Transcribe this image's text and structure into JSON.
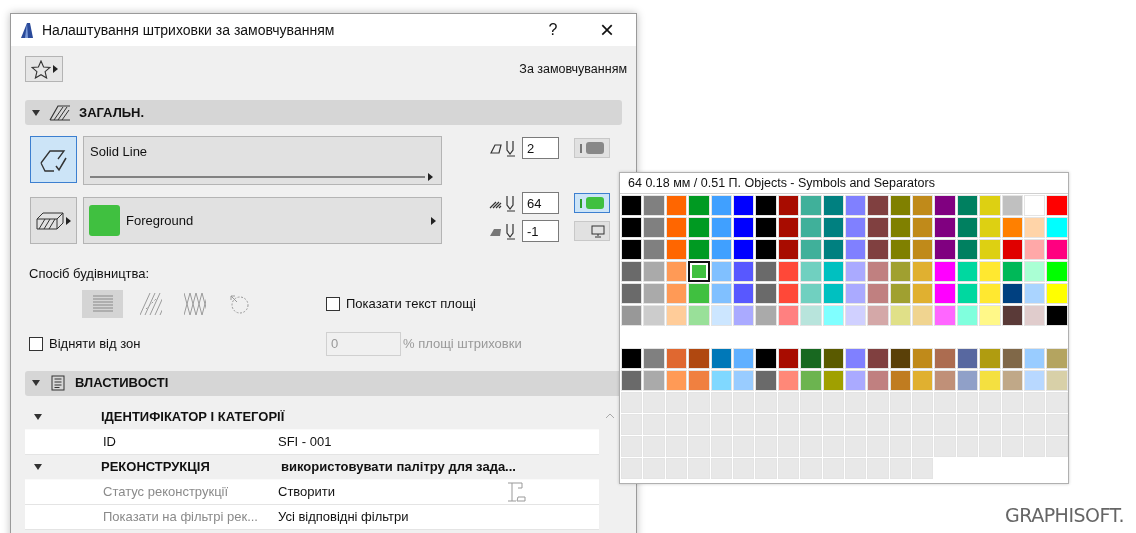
{
  "window": {
    "title": "Налаштування штриховки за замовчуванням",
    "help": "?",
    "close": "×"
  },
  "favorites": {
    "label": "За замовчуванням"
  },
  "general": {
    "title": "ЗАГАЛЬН.",
    "expanded": true,
    "line_type": {
      "label": "Solid Line",
      "selected": true
    },
    "fill": {
      "label": "Foreground",
      "color": "#40c040"
    },
    "pens": [
      {
        "kind": "contour",
        "value": "2",
        "toggle_on": false
      },
      {
        "kind": "foreground",
        "value": "64",
        "toggle_on": true
      },
      {
        "kind": "background",
        "value": "-1"
      }
    ],
    "construction_label": "Спосіб будівництва:",
    "construction_methods": [
      {
        "kind": "solid",
        "selected": true
      },
      {
        "kind": "hatched",
        "selected": false
      },
      {
        "kind": "crossed",
        "selected": false
      },
      {
        "kind": "rotated",
        "selected": false
      }
    ],
    "show_area_text": {
      "label": "Показати текст площі",
      "checked": false
    },
    "subtract_zones": {
      "label": "Відняти від зон",
      "checked": false
    },
    "area_percent": {
      "value": "0",
      "suffix": "% площі штриховки",
      "disabled": true
    }
  },
  "properties": {
    "title": "ВЛАСТИВОСТІ",
    "expanded": true,
    "groups": [
      {
        "name": "ІДЕНТИФІКАТОР І КАТЕГОРІЇ",
        "expanded": true,
        "children": [
          {
            "name": "ID",
            "value": "SFI - 001",
            "disabled": false
          }
        ]
      },
      {
        "name": "РЕКОНСТРУКЦІЯ",
        "value": "використовувати палітру для зада...",
        "expanded": true,
        "children": [
          {
            "name": "Статус реконструкції",
            "value": "Створити",
            "disabled": true,
            "has_icon": true
          },
          {
            "name": "Показати на фільтрі рек...",
            "value": "Усі відповідні фільтри",
            "disabled": true
          }
        ]
      }
    ]
  },
  "palette": {
    "header": "64  0.18 мм /  0.51 П. Objects - Symbols and Separators",
    "groups": [
      {
        "rows": [
          [
            {
              "color": "#000000",
              "selected": false
            },
            {
              "color": "#808080",
              "selected": false
            },
            {
              "color": "#ff6600",
              "selected": false
            },
            {
              "color": "#009a22",
              "selected": false
            },
            {
              "color": "#40a0ff",
              "selected": false
            },
            {
              "color": "#0000ff",
              "selected": false
            },
            {
              "color": "#000000",
              "selected": false
            },
            {
              "color": "#a80c00",
              "selected": false
            },
            {
              "color": "#40b09a",
              "selected": false
            },
            {
              "color": "#008080",
              "selected": false
            },
            {
              "color": "#8080ff",
              "selected": false
            },
            {
              "color": "#804040",
              "selected": false
            },
            {
              "color": "#808000",
              "selected": false
            },
            {
              "color": "#c08a1a",
              "selected": false
            },
            {
              "color": "#800080",
              "selected": false
            },
            {
              "color": "#008060",
              "selected": false
            },
            {
              "color": "#ddd012",
              "selected": false
            },
            {
              "color": "#c0c0c0",
              "selected": false
            },
            {
              "color": "#ffffff",
              "selected": false
            },
            {
              "color": "#ff0000",
              "selected": false
            }
          ],
          [
            {
              "color": "#000000",
              "selected": false
            },
            {
              "color": "#808080",
              "selected": false
            },
            {
              "color": "#ff6600",
              "selected": false
            },
            {
              "color": "#009a22",
              "selected": false
            },
            {
              "color": "#40a0ff",
              "selected": false
            },
            {
              "color": "#0000ff",
              "selected": false
            },
            {
              "color": "#000000",
              "selected": false
            },
            {
              "color": "#a80c00",
              "selected": false
            },
            {
              "color": "#40b09a",
              "selected": false
            },
            {
              "color": "#008080",
              "selected": false
            },
            {
              "color": "#8080ff",
              "selected": false
            },
            {
              "color": "#804040",
              "selected": false
            },
            {
              "color": "#808000",
              "selected": false
            },
            {
              "color": "#c08a1a",
              "selected": false
            },
            {
              "color": "#800080",
              "selected": false
            },
            {
              "color": "#008060",
              "selected": false
            },
            {
              "color": "#ddd012",
              "selected": false
            },
            {
              "color": "#ff8000",
              "selected": false
            },
            {
              "color": "#ffd4a8",
              "selected": false
            },
            {
              "color": "#00ffff",
              "selected": false
            }
          ],
          [
            {
              "color": "#000000",
              "selected": false
            },
            {
              "color": "#808080",
              "selected": false
            },
            {
              "color": "#ff6600",
              "selected": false
            },
            {
              "color": "#009a22",
              "selected": false
            },
            {
              "color": "#40a0ff",
              "selected": false
            },
            {
              "color": "#0000ff",
              "selected": false
            },
            {
              "color": "#000000",
              "selected": false
            },
            {
              "color": "#a80c00",
              "selected": false
            },
            {
              "color": "#40b09a",
              "selected": false
            },
            {
              "color": "#008080",
              "selected": false
            },
            {
              "color": "#8080ff",
              "selected": false
            },
            {
              "color": "#804040",
              "selected": false
            },
            {
              "color": "#808000",
              "selected": false
            },
            {
              "color": "#c08a1a",
              "selected": false
            },
            {
              "color": "#800080",
              "selected": false
            },
            {
              "color": "#008060",
              "selected": false
            },
            {
              "color": "#ddd012",
              "selected": false
            },
            {
              "color": "#e00000",
              "selected": false
            },
            {
              "color": "#ffa8a8",
              "selected": false
            },
            {
              "color": "#ff0080",
              "selected": false
            }
          ],
          [
            {
              "color": "#6a6a6a",
              "selected": false
            },
            {
              "color": "#aaaaaa",
              "selected": false
            },
            {
              "color": "#ff9a56",
              "selected": false
            },
            {
              "color": "#40c040",
              "selected": true
            },
            {
              "color": "#80c0ff",
              "selected": false
            },
            {
              "color": "#5858ff",
              "selected": false
            },
            {
              "color": "#6a6a6a",
              "selected": false
            },
            {
              "color": "#ff4838",
              "selected": false
            },
            {
              "color": "#70d0c0",
              "selected": false
            },
            {
              "color": "#00c0c0",
              "selected": false
            },
            {
              "color": "#aaaaff",
              "selected": false
            },
            {
              "color": "#c08080",
              "selected": false
            },
            {
              "color": "#a0a030",
              "selected": false
            },
            {
              "color": "#e0b030",
              "selected": false
            },
            {
              "color": "#ff00ff",
              "selected": false
            },
            {
              "color": "#00d8a0",
              "selected": false
            },
            {
              "color": "#ffe830",
              "selected": false
            },
            {
              "color": "#00b858",
              "selected": false
            },
            {
              "color": "#aaffd4",
              "selected": false
            },
            {
              "color": "#00ff00",
              "selected": false
            }
          ],
          [
            {
              "color": "#6a6a6a",
              "selected": false
            },
            {
              "color": "#aaaaaa",
              "selected": false
            },
            {
              "color": "#ff9a56",
              "selected": false
            },
            {
              "color": "#40c040",
              "selected": false
            },
            {
              "color": "#80c0ff",
              "selected": false
            },
            {
              "color": "#5858ff",
              "selected": false
            },
            {
              "color": "#6a6a6a",
              "selected": false
            },
            {
              "color": "#ff4838",
              "selected": false
            },
            {
              "color": "#70d0c0",
              "selected": false
            },
            {
              "color": "#00c0c0",
              "selected": false
            },
            {
              "color": "#aaaaff",
              "selected": false
            },
            {
              "color": "#c08080",
              "selected": false
            },
            {
              "color": "#a0a030",
              "selected": false
            },
            {
              "color": "#e0b030",
              "selected": false
            },
            {
              "color": "#ff00ff",
              "selected": false
            },
            {
              "color": "#00d8a0",
              "selected": false
            },
            {
              "color": "#ffe830",
              "selected": false
            },
            {
              "color": "#004080",
              "selected": false
            },
            {
              "color": "#aad4ff",
              "selected": false
            },
            {
              "color": "#ffff00",
              "selected": false
            }
          ],
          [
            {
              "color": "#989898",
              "selected": false
            },
            {
              "color": "#cccccc",
              "selected": false
            },
            {
              "color": "#ffcc99",
              "selected": false
            },
            {
              "color": "#99e099",
              "selected": false
            },
            {
              "color": "#cce6ff",
              "selected": false
            },
            {
              "color": "#aaaaff",
              "selected": false
            },
            {
              "color": "#aaaaaa",
              "selected": false
            },
            {
              "color": "#ff8080",
              "selected": false
            },
            {
              "color": "#b8e4dc",
              "selected": false
            },
            {
              "color": "#80ffff",
              "selected": false
            },
            {
              "color": "#d0d0ff",
              "selected": false
            },
            {
              "color": "#d4a8a8",
              "selected": false
            },
            {
              "color": "#e0e088",
              "selected": false
            },
            {
              "color": "#f0d490",
              "selected": false
            },
            {
              "color": "#ff66ff",
              "selected": false
            },
            {
              "color": "#80ffdd",
              "selected": false
            },
            {
              "color": "#fff888",
              "selected": false
            },
            {
              "color": "#5a3a38",
              "selected": false
            },
            {
              "color": "#e0cccc",
              "selected": false
            },
            {
              "color": "#000000",
              "selected": false
            }
          ]
        ]
      },
      {
        "rows": [
          [
            {
              "color": "#000000",
              "selected": false
            },
            {
              "color": "#808080",
              "selected": false
            },
            {
              "color": "#e06830",
              "selected": false
            },
            {
              "color": "#b04810",
              "selected": false
            },
            {
              "color": "#0078b8",
              "selected": false
            },
            {
              "color": "#60b0ff",
              "selected": false
            },
            {
              "color": "#000000",
              "selected": false
            },
            {
              "color": "#a80c00",
              "selected": false
            },
            {
              "color": "#186820",
              "selected": false
            },
            {
              "color": "#5a5a00",
              "selected": false
            },
            {
              "color": "#8080ff",
              "selected": false
            },
            {
              "color": "#804040",
              "selected": false
            },
            {
              "color": "#5a4008",
              "selected": false
            },
            {
              "color": "#c08a1a",
              "selected": false
            },
            {
              "color": "#ac6c50",
              "selected": false
            },
            {
              "color": "#5868a0",
              "selected": false
            },
            {
              "color": "#b09c10",
              "selected": false
            },
            {
              "color": "#806848",
              "selected": false
            },
            {
              "color": "#99ccff",
              "selected": false
            },
            {
              "color": "#b4a460",
              "selected": false
            }
          ],
          [
            {
              "color": "#6a6a6a",
              "selected": false
            },
            {
              "color": "#aaaaaa",
              "selected": false
            },
            {
              "color": "#ff9a56",
              "selected": false
            },
            {
              "color": "#f08040",
              "selected": false
            },
            {
              "color": "#80d8ff",
              "selected": false
            },
            {
              "color": "#99ccff",
              "selected": false
            },
            {
              "color": "#6a6a6a",
              "selected": false
            },
            {
              "color": "#ff8878",
              "selected": false
            },
            {
              "color": "#6cb450",
              "selected": false
            },
            {
              "color": "#a0a000",
              "selected": false
            },
            {
              "color": "#aaaaff",
              "selected": false
            },
            {
              "color": "#c08080",
              "selected": false
            },
            {
              "color": "#c07c20",
              "selected": false
            },
            {
              "color": "#e0b030",
              "selected": false
            },
            {
              "color": "#c09078",
              "selected": false
            },
            {
              "color": "#90a0c8",
              "selected": false
            },
            {
              "color": "#f4e040",
              "selected": false
            },
            {
              "color": "#c0a888",
              "selected": false
            },
            {
              "color": "#b8d8ff",
              "selected": false
            },
            {
              "color": "#d8d0a8",
              "selected": false
            }
          ],
          [
            {
              "color": "#e8e8e8",
              "selected": false
            },
            {
              "color": "#e8e8e8",
              "selected": false
            },
            {
              "color": "#e8e8e8",
              "selected": false
            },
            {
              "color": "#e8e8e8",
              "selected": false
            },
            {
              "color": "#e8e8e8",
              "selected": false
            },
            {
              "color": "#e8e8e8",
              "selected": false
            },
            {
              "color": "#e8e8e8",
              "selected": false
            },
            {
              "color": "#e8e8e8",
              "selected": false
            },
            {
              "color": "#e8e8e8",
              "selected": false
            },
            {
              "color": "#e8e8e8",
              "selected": false
            },
            {
              "color": "#e8e8e8",
              "selected": false
            },
            {
              "color": "#e8e8e8",
              "selected": false
            },
            {
              "color": "#e8e8e8",
              "selected": false
            },
            {
              "color": "#e8e8e8",
              "selected": false
            },
            {
              "color": "#e8e8e8",
              "selected": false
            },
            {
              "color": "#e8e8e8",
              "selected": false
            },
            {
              "color": "#e8e8e8",
              "selected": false
            },
            {
              "color": "#e8e8e8",
              "selected": false
            },
            {
              "color": "#e8e8e8",
              "selected": false
            },
            {
              "color": "#e8e8e8",
              "selected": false
            }
          ],
          [
            {
              "color": "#e8e8e8",
              "selected": false
            },
            {
              "color": "#e8e8e8",
              "selected": false
            },
            {
              "color": "#e8e8e8",
              "selected": false
            },
            {
              "color": "#e8e8e8",
              "selected": false
            },
            {
              "color": "#e8e8e8",
              "selected": false
            },
            {
              "color": "#e8e8e8",
              "selected": false
            },
            {
              "color": "#e8e8e8",
              "selected": false
            },
            {
              "color": "#e8e8e8",
              "selected": false
            },
            {
              "color": "#e8e8e8",
              "selected": false
            },
            {
              "color": "#e8e8e8",
              "selected": false
            },
            {
              "color": "#e8e8e8",
              "selected": false
            },
            {
              "color": "#e8e8e8",
              "selected": false
            },
            {
              "color": "#e8e8e8",
              "selected": false
            },
            {
              "color": "#e8e8e8",
              "selected": false
            },
            {
              "color": "#e8e8e8",
              "selected": false
            },
            {
              "color": "#e8e8e8",
              "selected": false
            },
            {
              "color": "#e8e8e8",
              "selected": false
            },
            {
              "color": "#e8e8e8",
              "selected": false
            },
            {
              "color": "#e8e8e8",
              "selected": false
            },
            {
              "color": "#e8e8e8",
              "selected": false
            }
          ],
          [
            {
              "color": "#e8e8e8",
              "selected": false
            },
            {
              "color": "#e8e8e8",
              "selected": false
            },
            {
              "color": "#e8e8e8",
              "selected": false
            },
            {
              "color": "#e8e8e8",
              "selected": false
            },
            {
              "color": "#e8e8e8",
              "selected": false
            },
            {
              "color": "#e8e8e8",
              "selected": false
            },
            {
              "color": "#e8e8e8",
              "selected": false
            },
            {
              "color": "#e8e8e8",
              "selected": false
            },
            {
              "color": "#e8e8e8",
              "selected": false
            },
            {
              "color": "#e8e8e8",
              "selected": false
            },
            {
              "color": "#e8e8e8",
              "selected": false
            },
            {
              "color": "#e8e8e8",
              "selected": false
            },
            {
              "color": "#e8e8e8",
              "selected": false
            },
            {
              "color": "#e8e8e8",
              "selected": false
            },
            {
              "color": "#e8e8e8",
              "selected": false
            },
            {
              "color": "#e8e8e8",
              "selected": false
            },
            {
              "color": "#e8e8e8",
              "selected": false
            },
            {
              "color": "#e8e8e8",
              "selected": false
            },
            {
              "color": "#e8e8e8",
              "selected": false
            },
            {
              "color": "#e8e8e8",
              "selected": false
            }
          ],
          [
            {
              "color": "#e8e8e8",
              "selected": false
            },
            {
              "color": "#e8e8e8",
              "selected": false
            },
            {
              "color": "#e8e8e8",
              "selected": false
            },
            {
              "color": "#e8e8e8",
              "selected": false
            },
            {
              "color": "#e8e8e8",
              "selected": false
            },
            {
              "color": "#e8e8e8",
              "selected": false
            },
            {
              "color": "#e8e8e8",
              "selected": false
            },
            {
              "color": "#e8e8e8",
              "selected": false
            },
            {
              "color": "#e8e8e8",
              "selected": false
            },
            {
              "color": "#e8e8e8",
              "selected": false
            },
            {
              "color": "#e8e8e8",
              "selected": false
            },
            {
              "color": "#e8e8e8",
              "selected": false
            },
            {
              "color": "#e8e8e8",
              "selected": false
            },
            {
              "color": "#e8e8e8",
              "selected": false
            }
          ]
        ]
      }
    ]
  },
  "brand": {
    "label": "GRAPHISOFT."
  }
}
